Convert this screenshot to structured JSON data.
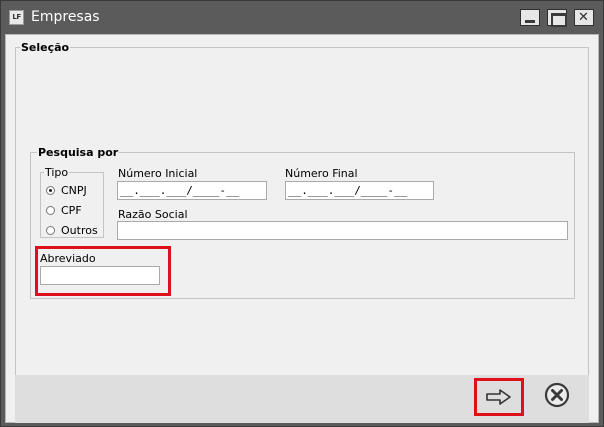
{
  "window": {
    "title": "Empresas",
    "app_icon_text": "LF"
  },
  "selecao": {
    "label": "Seleção"
  },
  "pesquisa": {
    "label": "Pesquisa por",
    "tipo": {
      "label": "Tipo",
      "options": [
        "CNPJ",
        "CPF",
        "Outros"
      ],
      "selected": "CNPJ"
    },
    "numero_inicial": {
      "label": "Número Inicial",
      "value": "__.___.___/____-__"
    },
    "numero_final": {
      "label": "Número Final",
      "value": "__.___.___/____-__"
    },
    "razao_social": {
      "label": "Razão Social",
      "value": ""
    },
    "abreviado": {
      "label": "Abreviado",
      "value": ""
    }
  },
  "footer": {
    "next_icon": "arrow-right-icon",
    "cancel_icon": "close-circle-icon"
  },
  "colors": {
    "titlebar": "#5b5b5b",
    "highlight": "#e0101a",
    "panel": "#f0f0f0"
  }
}
